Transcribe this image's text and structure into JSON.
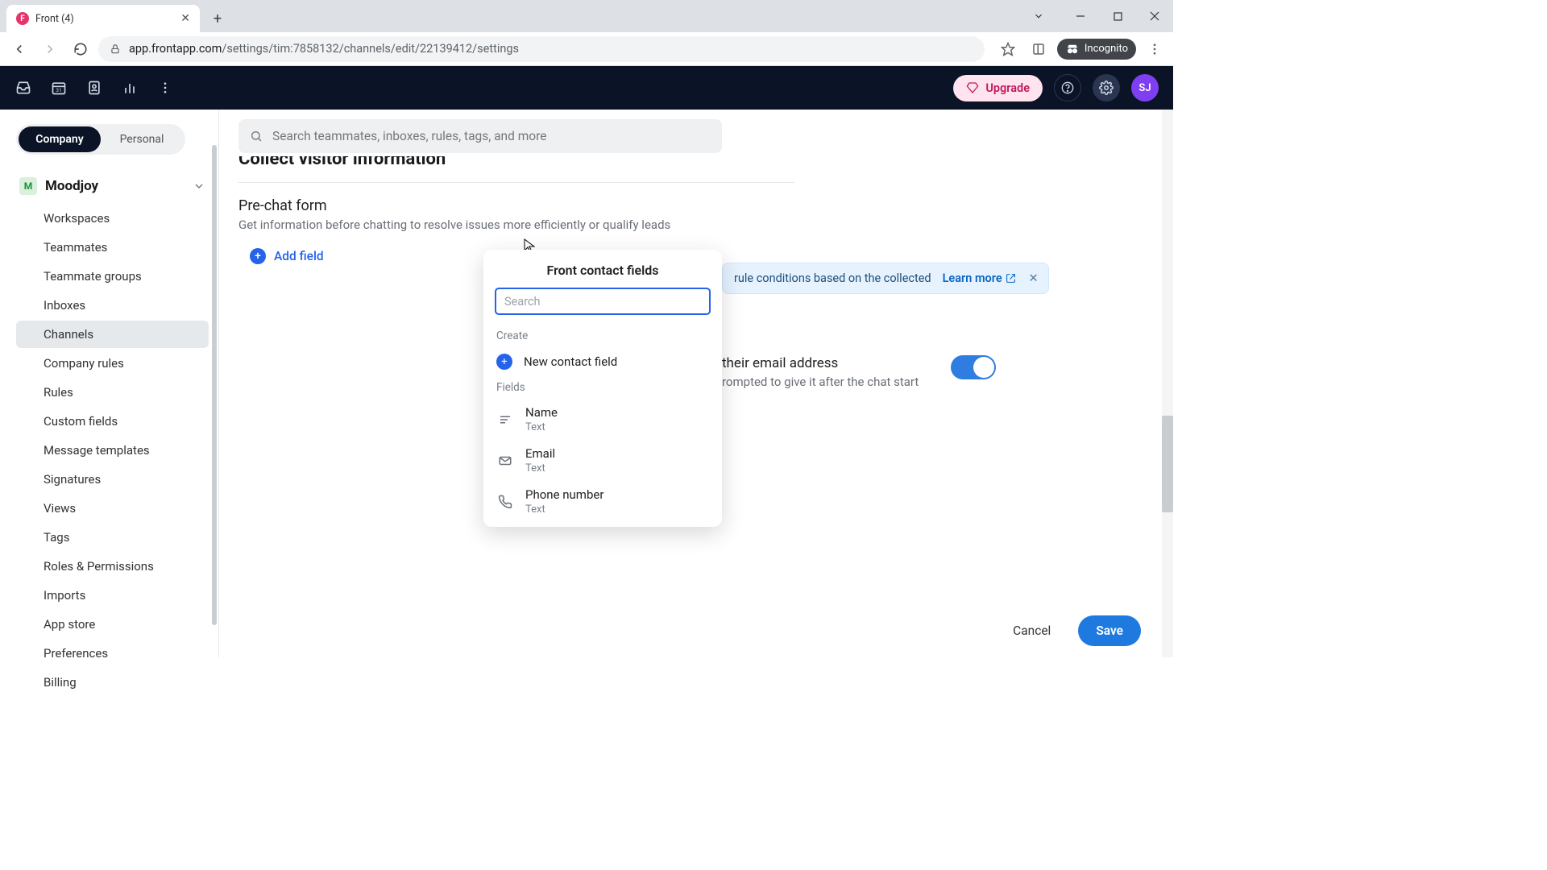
{
  "browser": {
    "tab_title": "Front (4)",
    "url_domain": "app.frontapp.com",
    "url_path": "/settings/tim:7858132/channels/edit/22139412/settings",
    "incognito_label": "Incognito"
  },
  "header": {
    "upgrade_label": "Upgrade",
    "avatar_initials": "SJ"
  },
  "sidebar": {
    "seg_company": "Company",
    "seg_personal": "Personal",
    "workspace_initial": "M",
    "workspace_name": "Moodjoy",
    "items": [
      {
        "label": "Workspaces"
      },
      {
        "label": "Teammates"
      },
      {
        "label": "Teammate groups"
      },
      {
        "label": "Inboxes"
      },
      {
        "label": "Channels"
      },
      {
        "label": "Company rules"
      },
      {
        "label": "Rules"
      },
      {
        "label": "Custom fields"
      },
      {
        "label": "Message templates"
      },
      {
        "label": "Signatures"
      },
      {
        "label": "Views"
      },
      {
        "label": "Tags"
      },
      {
        "label": "Roles & Permissions"
      },
      {
        "label": "Imports"
      },
      {
        "label": "App store"
      },
      {
        "label": "Preferences"
      },
      {
        "label": "Billing"
      }
    ]
  },
  "main": {
    "search_placeholder": "Search teammates, inboxes, rules, tags, and more",
    "section_title": "Collect visitor information",
    "sub_title": "Pre-chat form",
    "sub_desc": "Get information before chatting to resolve issues more efficiently or qualify leads",
    "add_field_label": "Add field",
    "banner_text": "rule conditions based on the collected",
    "banner_learn": "Learn more",
    "toggle_title_fragment": "their email address",
    "toggle_desc_fragment": "rompted to give it after the chat start",
    "cancel_label": "Cancel",
    "save_label": "Save"
  },
  "popover": {
    "title": "Front contact fields",
    "search_placeholder": "Search",
    "create_label": "Create",
    "new_field_label": "New contact field",
    "fields_label": "Fields",
    "fields": [
      {
        "name": "Name",
        "type": "Text",
        "icon": "text"
      },
      {
        "name": "Email",
        "type": "Text",
        "icon": "mail"
      },
      {
        "name": "Phone number",
        "type": "Text",
        "icon": "phone"
      }
    ]
  }
}
